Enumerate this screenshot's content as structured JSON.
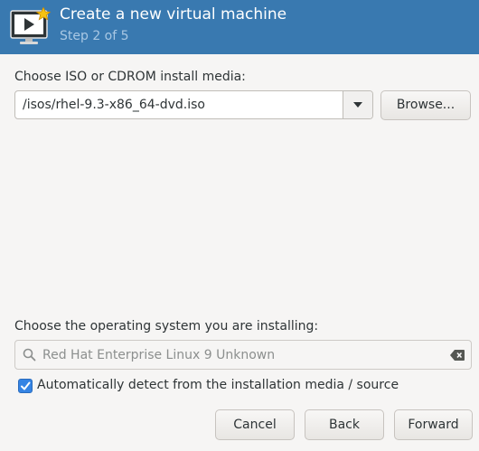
{
  "header": {
    "title": "Create a new virtual machine",
    "subtitle": "Step 2 of 5",
    "icon": "monitor-play-icon"
  },
  "media": {
    "label": "Choose ISO or CDROM install media:",
    "value": "/isos/rhel-9.3-x86_64-dvd.iso",
    "browse_label": "Browse..."
  },
  "os": {
    "label": "Choose the operating system you are installing:",
    "search_value": "Red Hat Enterprise Linux 9 Unknown",
    "auto_detect_label": "Automatically detect from the installation media / source",
    "auto_detect_checked": true
  },
  "footer": {
    "cancel_label": "Cancel",
    "back_label": "Back",
    "forward_label": "Forward"
  },
  "colors": {
    "header_bg": "#3979b0",
    "subtitle": "#a9c8e4",
    "checkbox_accent": "#3584e4"
  }
}
